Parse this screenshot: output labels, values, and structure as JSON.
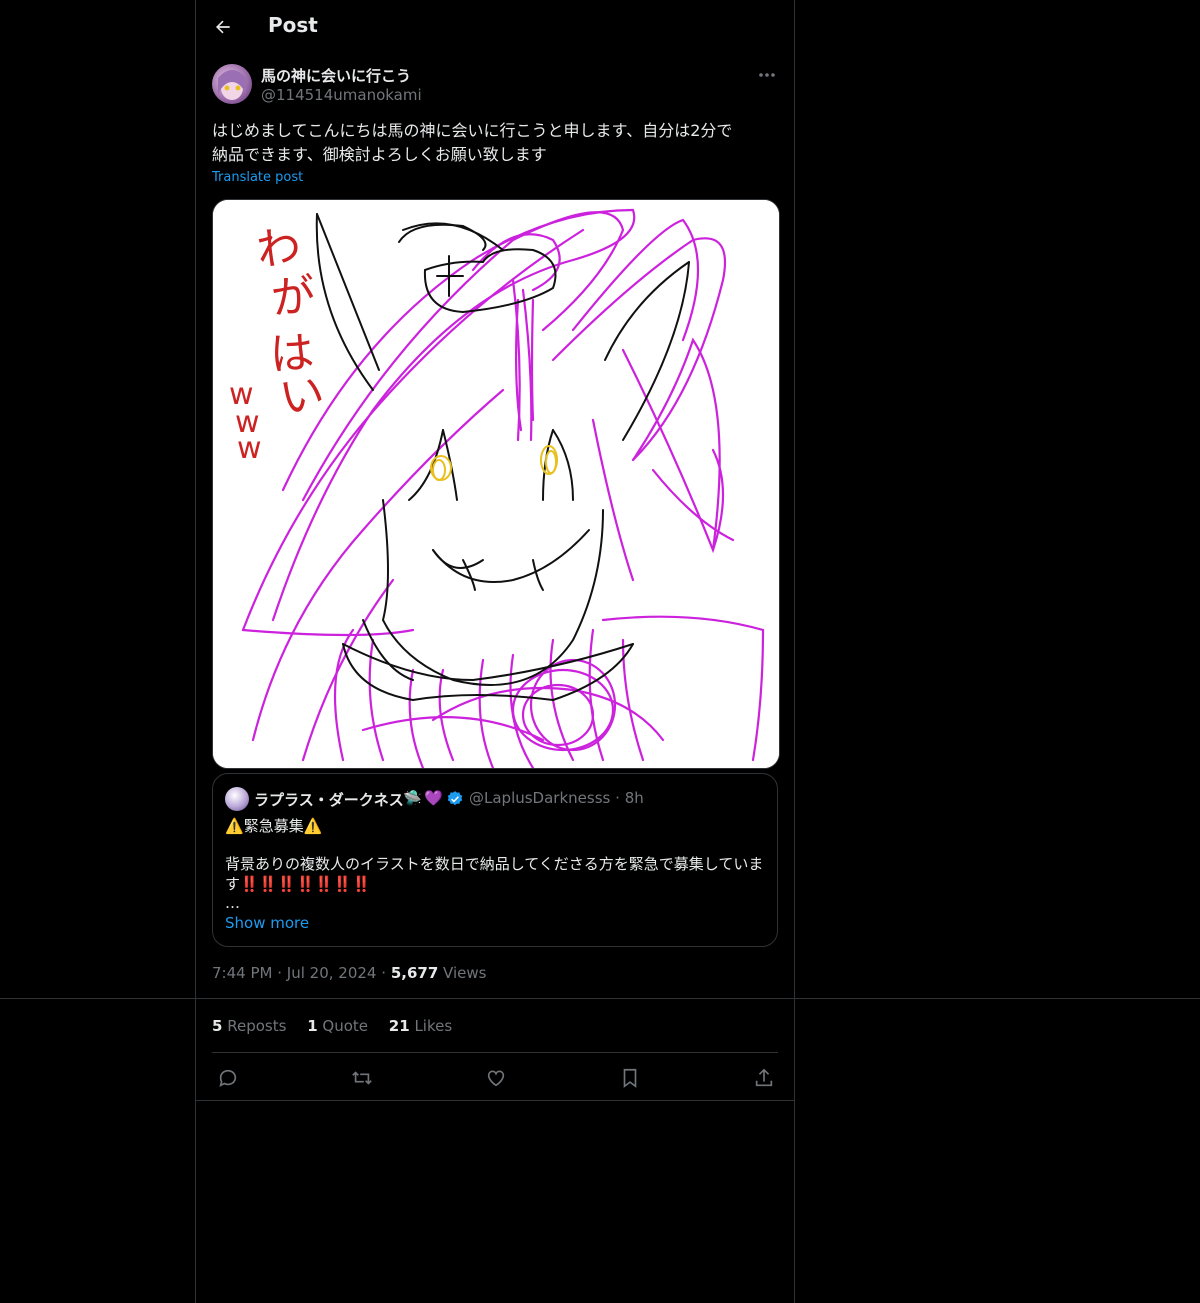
{
  "header": {
    "title": "Post"
  },
  "post": {
    "display_name": "馬の神に会いに行こう",
    "handle": "@114514umanokami",
    "text_line1": "はじめましてこんにちは馬の神に会いに行こうと申します、自分は2分で",
    "text_line2": "納品できます、御検討よろしくお願い致します",
    "translate_label": "Translate post",
    "drawing_text": [
      "わ",
      "が",
      "は",
      "い",
      "w",
      "w",
      "w"
    ]
  },
  "quote": {
    "name": "ラプラス・ダークネス",
    "emoji1": "🛸",
    "emoji2": "💜",
    "handle": "@LaplusDarknesss",
    "sep": "·",
    "time": "8h",
    "title_warn_left": "⚠️",
    "title_text": "緊急募集",
    "title_warn_right": "⚠️",
    "body_line1": "背景ありの複数人のイラストを数日で納品してくださる方を緊急で募集していま",
    "body_line2_prefix": "す",
    "body_line2_marks": "‼️‼️‼️‼️‼️‼️‼️",
    "ellipsis": "…",
    "show_more": "Show more"
  },
  "meta": {
    "time": "7:44 PM",
    "sep1": "·",
    "date": "Jul 20, 2024",
    "sep2": "·",
    "views_count": "5,677",
    "views_label": "Views"
  },
  "stats": {
    "reposts_count": "5",
    "reposts_label": "Reposts",
    "quotes_count": "1",
    "quotes_label": "Quote",
    "likes_count": "21",
    "likes_label": "Likes"
  },
  "icons": {
    "back": "arrow-left-icon",
    "more": "more-horizontal-icon",
    "verified": "verified-badge-icon",
    "reply": "reply-icon",
    "repost": "repost-icon",
    "like": "heart-icon",
    "bookmark": "bookmark-icon",
    "share": "share-icon"
  },
  "colors": {
    "accent": "#1d9bf0",
    "background": "#000000",
    "muted": "#71767b",
    "border": "#2f3336",
    "drawing_purple": "#cc22dd",
    "drawing_red": "#cc2222",
    "drawing_yellow": "#e8c020"
  }
}
